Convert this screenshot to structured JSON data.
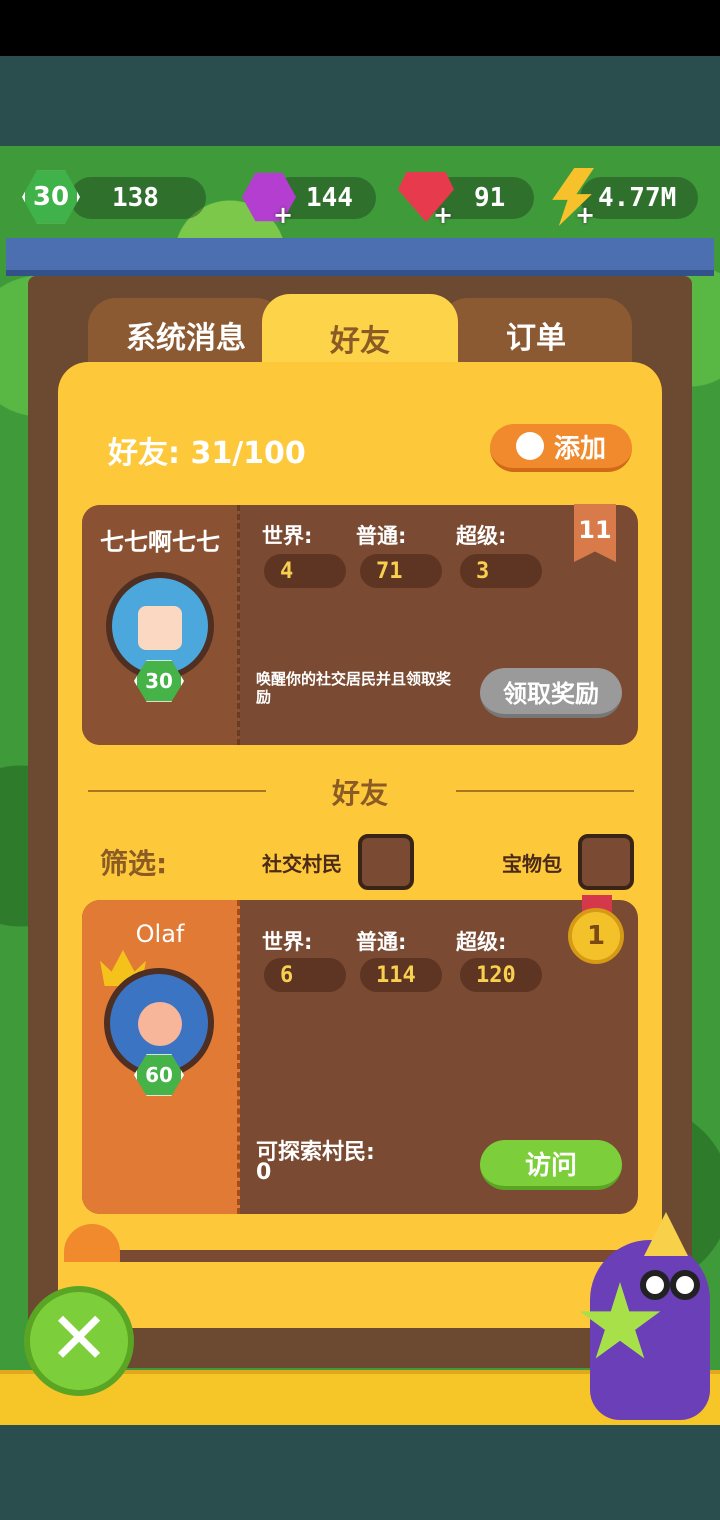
{
  "resources": {
    "level": "30",
    "xp": "138",
    "gems": "144",
    "rubies": "91",
    "energy": "4.77M"
  },
  "tabs": [
    {
      "label": "系统消息",
      "active": false
    },
    {
      "label": "好友",
      "active": true
    },
    {
      "label": "订单",
      "active": false
    }
  ],
  "friends_header": {
    "count_label": "好友: 31/100",
    "add_button": "添加"
  },
  "own_card": {
    "name": "七七啊七七",
    "level": "30",
    "rank_badge": "11",
    "stats": [
      {
        "label": "世界:",
        "value": "4"
      },
      {
        "label": "普通:",
        "value": "71"
      },
      {
        "label": "超级:",
        "value": "3"
      }
    ],
    "message": "唤醒你的社交居民并且领取奖励",
    "claim_button": "领取奖励"
  },
  "section_title": "好友",
  "filter": {
    "label": "筛选:",
    "option1": "社交村民",
    "option2": "宝物包"
  },
  "friend_card": {
    "name": "Olaf",
    "level": "60",
    "medal": "1",
    "stats": [
      {
        "label": "世界:",
        "value": "6"
      },
      {
        "label": "普通:",
        "value": "114"
      },
      {
        "label": "超级:",
        "value": "120"
      }
    ],
    "explore_label": "可探索村民:",
    "explore_value": "0",
    "visit_button": "访问"
  },
  "colors": {
    "panel": "#fdc93b",
    "card": "#7a4a32",
    "accent_orange": "#f08a2c",
    "green_button": "#7ccf3a"
  }
}
